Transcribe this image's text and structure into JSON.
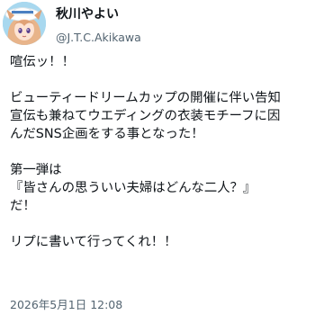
{
  "author": {
    "display_name": "秋川やよい",
    "handle": "@J.T.C.Akikawa",
    "avatar_icon": "anime-character-avatar-icon"
  },
  "tweet": {
    "lines": [
      "喧伝ッ！！",
      "ビューティードリームカップの開催に伴い告知",
      "宣伝も兼ねてウエディングの衣装モチーフに因",
      "んだSNS企画をする事となった！",
      "第一弾は",
      "『皆さんの思ういい夫婦はどんな二人？』",
      "だ！",
      "リプに書いて行ってくれ！！"
    ],
    "timestamp": "2026年5月1日 12:08"
  },
  "colors": {
    "text": "#0f1419",
    "secondary_text": "#536471",
    "background": "#ffffff"
  }
}
